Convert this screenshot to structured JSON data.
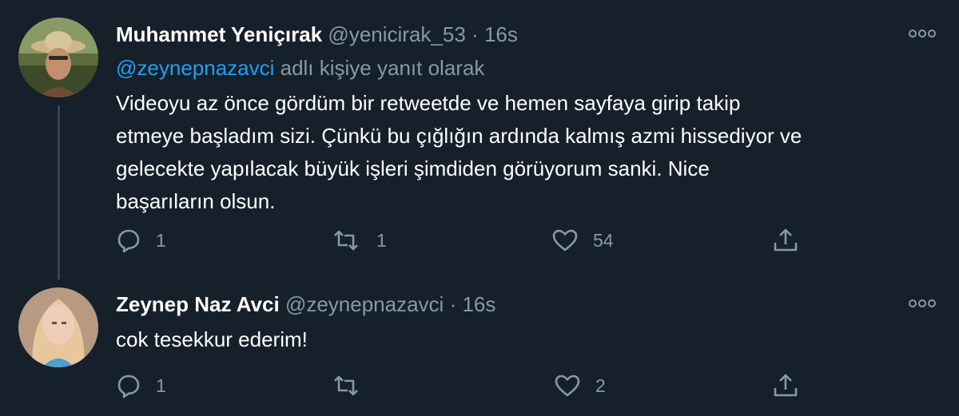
{
  "tweets": [
    {
      "name": "Muhammet Yeniçırak",
      "handle": "@yenicirak_53",
      "separator": "·",
      "time": "16s",
      "reply_prefix_mention": "@zeynepnazavci",
      "reply_suffix": " adlı kişiye yanıt olarak",
      "text_lines": [
        "Videoyu az önce gördüm bir retweetde ve hemen sayfaya girip takip",
        "etmeye başladım sizi. Çünkü bu çığlığın ardında kalmış azmi hissediyor ve",
        "gelecekte yapılacak büyük işleri şimdiden görüyorum sanki. Nice",
        "başarıların olsun."
      ],
      "reply_count": "1",
      "retweet_count": "1",
      "like_count": "54",
      "icons": [
        "reply-icon",
        "retweet-icon",
        "like-icon",
        "share-icon",
        "more-icon"
      ]
    },
    {
      "name": "Zeynep Naz Avci",
      "handle": "@zeynepnazavci",
      "separator": "·",
      "time": "16s",
      "text_lines": [
        "cok tesekkur ederim!"
      ],
      "reply_count": "1",
      "retweet_count": "",
      "like_count": "2",
      "icons": [
        "reply-icon",
        "retweet-icon",
        "like-icon",
        "share-icon",
        "more-icon"
      ]
    }
  ],
  "colors": {
    "background": "#15202b",
    "text": "#ffffff",
    "secondary": "#8899a6",
    "link": "#1da1f2",
    "thread_line": "#38444d"
  }
}
